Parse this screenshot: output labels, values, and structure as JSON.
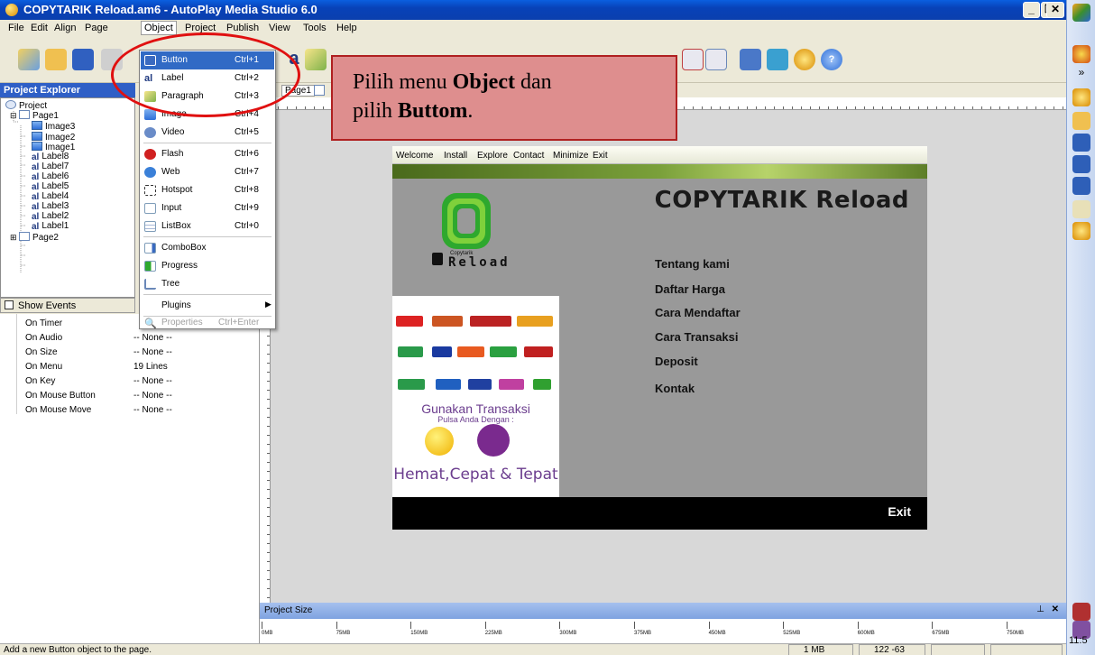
{
  "window": {
    "title": "COPYTARIK Reload.am6 - AutoPlay Media Studio 6.0"
  },
  "menubar": {
    "items": [
      "File",
      "Edit",
      "Align",
      "Page",
      "Object",
      "Project",
      "Publish",
      "View",
      "Tools",
      "Help"
    ]
  },
  "explorer": {
    "title": "Project Explorer",
    "tree": [
      "Project",
      "Page1",
      "Image3",
      "Image2",
      "Image1",
      "Label8",
      "Label7",
      "Label6",
      "Label5",
      "Label4",
      "Label3",
      "Label2",
      "Label1",
      "Page2"
    ],
    "show_events": "Show Events"
  },
  "events": {
    "rows": [
      {
        "name": "On Timer",
        "value": ""
      },
      {
        "name": "On Audio",
        "value": "-- None --"
      },
      {
        "name": "On Size",
        "value": "-- None --"
      },
      {
        "name": "On Menu",
        "value": "19 Lines"
      },
      {
        "name": "On Key",
        "value": "-- None --"
      },
      {
        "name": "On Mouse Button",
        "value": "-- None --"
      },
      {
        "name": "On Mouse Move",
        "value": "-- None --"
      }
    ]
  },
  "object_menu": {
    "items": [
      {
        "label": "Button",
        "shortcut": "Ctrl+1",
        "icon": "button-icon"
      },
      {
        "label": "Label",
        "shortcut": "Ctrl+2",
        "icon": "label-icon"
      },
      {
        "label": "Paragraph",
        "shortcut": "Ctrl+3",
        "icon": "paragraph-icon"
      },
      {
        "label": "Image",
        "shortcut": "Ctrl+4",
        "icon": "image-icon"
      },
      {
        "label": "Video",
        "shortcut": "Ctrl+5",
        "icon": "video-icon"
      },
      {
        "label": "Flash",
        "shortcut": "Ctrl+6",
        "icon": "flash-icon"
      },
      {
        "label": "Web",
        "shortcut": "Ctrl+7",
        "icon": "web-icon"
      },
      {
        "label": "Hotspot",
        "shortcut": "Ctrl+8",
        "icon": "hotspot-icon"
      },
      {
        "label": "Input",
        "shortcut": "Ctrl+9",
        "icon": "input-icon"
      },
      {
        "label": "ListBox",
        "shortcut": "Ctrl+0",
        "icon": "listbox-icon"
      },
      {
        "label": "ComboBox",
        "shortcut": "",
        "icon": "combobox-icon"
      },
      {
        "label": "Progress",
        "shortcut": "",
        "icon": "progress-icon"
      },
      {
        "label": "Tree",
        "shortcut": "",
        "icon": "tree-icon"
      },
      {
        "label": "Plugins",
        "shortcut": "",
        "icon": ""
      },
      {
        "label": "Properties",
        "shortcut": "Ctrl+Enter",
        "icon": "properties-icon"
      }
    ]
  },
  "doc_tab": "Page1",
  "callout": {
    "line1_pre": "Pilih menu ",
    "line1_bold": "Object",
    "line1_post": " dan",
    "line2_pre": "pilih ",
    "line2_bold": "Buttom",
    "line2_post": "."
  },
  "app_page": {
    "nav": [
      "Welcome",
      "Install",
      "Explore",
      "Contact",
      "Minimize",
      "Exit"
    ],
    "title": "COPYTARIK Reload",
    "logo_small": "Copytarik",
    "logo_text": "Reload",
    "menu": [
      "Tentang kami",
      "Daftar Harga",
      "Cara Mendaftar",
      "Cara Transaksi",
      "Deposit",
      "Kontak"
    ],
    "ad_line1": "Gunakan Transaksi",
    "ad_line2": "Pulsa Anda Dengan :",
    "ad_line3": "Hemat,Cepat & Tepat",
    "exit": "Exit"
  },
  "project_size": {
    "title": "Project Size",
    "labels": [
      "0MB",
      "75MB",
      "150MB",
      "225MB",
      "300MB",
      "375MB",
      "450MB",
      "525MB",
      "600MB",
      "675MB",
      "750MB"
    ]
  },
  "status": {
    "message": "Add a new Button object to the page.",
    "size": "1 MB",
    "coords": "122 -63"
  },
  "clock": "11:5",
  "colors": {
    "highlight": "#316ac5",
    "callout_bg": "#de8e8e",
    "callout_border": "#b02020",
    "ellipse": "#e01010"
  }
}
